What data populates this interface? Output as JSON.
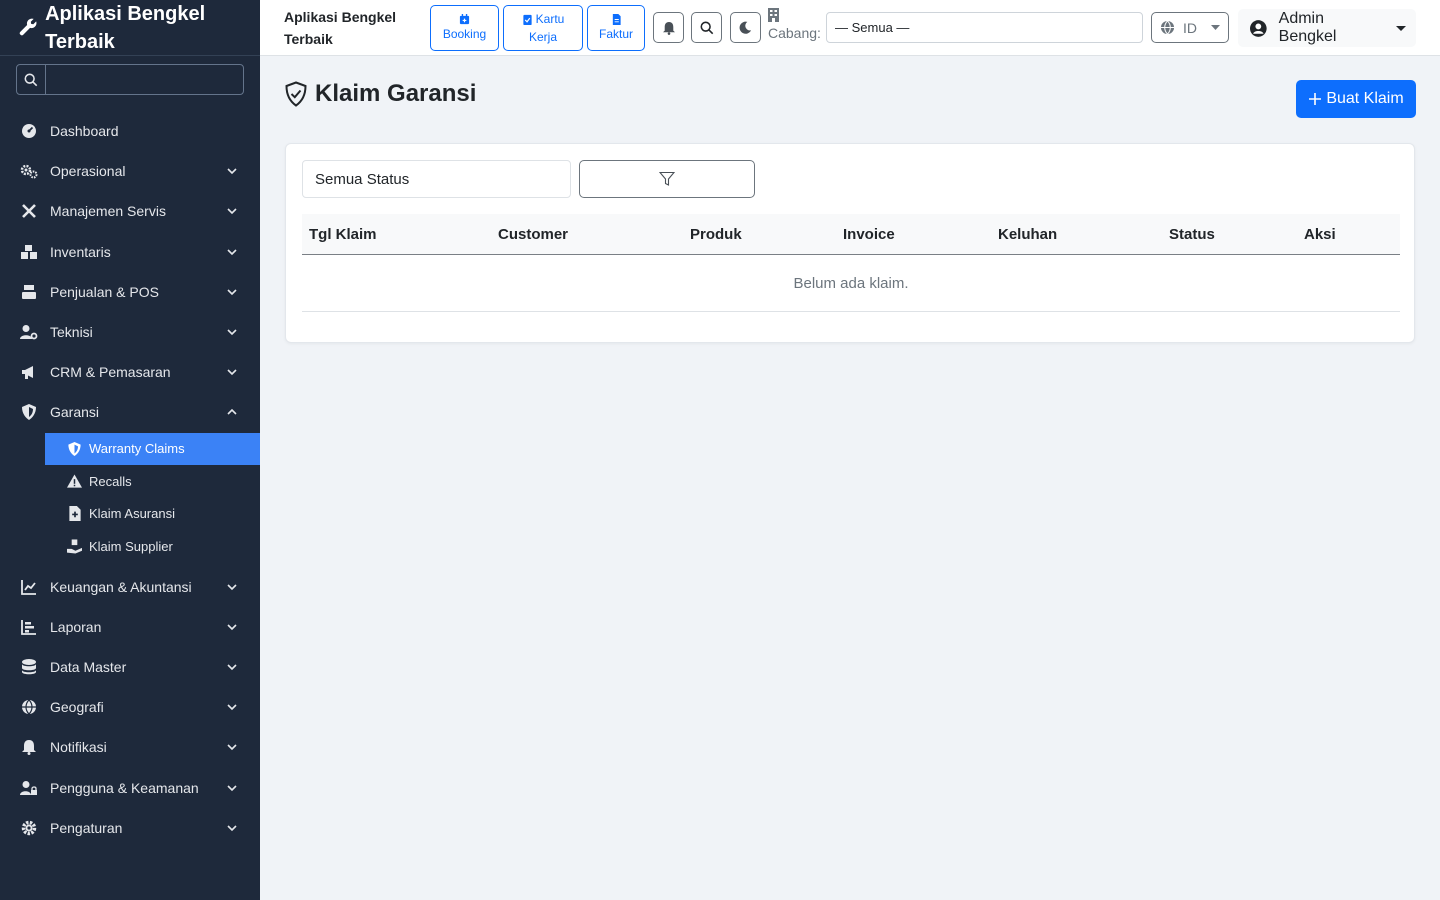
{
  "brand": {
    "title": "Aplikasi Bengkel Terbaik"
  },
  "sidebar": {
    "search_placeholder": "",
    "items": [
      {
        "label": "Dashboard",
        "icon": "dashboard-icon"
      },
      {
        "label": "Operasional",
        "icon": "gears-icon"
      },
      {
        "label": "Manajemen Servis",
        "icon": "tools-icon"
      },
      {
        "label": "Inventaris",
        "icon": "boxes-icon"
      },
      {
        "label": "Penjualan & POS",
        "icon": "cash-register-icon"
      },
      {
        "label": "Teknisi",
        "icon": "user-gear-icon"
      },
      {
        "label": "CRM & Pemasaran",
        "icon": "megaphone-icon"
      },
      {
        "label": "Garansi",
        "icon": "shield-icon"
      }
    ],
    "garansi_sub": [
      {
        "label": "Warranty Claims"
      },
      {
        "label": "Recalls"
      },
      {
        "label": "Klaim Asuransi"
      },
      {
        "label": "Klaim Supplier"
      }
    ],
    "items_after": [
      {
        "label": "Keuangan & Akuntansi"
      },
      {
        "label": "Laporan"
      },
      {
        "label": "Data Master"
      },
      {
        "label": "Geografi"
      },
      {
        "label": "Notifikasi"
      },
      {
        "label": "Pengguna & Keamanan"
      },
      {
        "label": "Pengaturan"
      }
    ]
  },
  "topbar": {
    "app_name": "Aplikasi Bengkel Terbaik",
    "booking": "Booking",
    "kartu_kerja_1": "Kartu",
    "kartu_kerja_2": "Kerja",
    "faktur": "Faktur",
    "cabang_label": "Cabang:",
    "cabang_value": "— Semua —",
    "lang": "ID",
    "user": "Admin Bengkel"
  },
  "main": {
    "title": "Klaim Garansi",
    "new_button": "Buat Klaim",
    "status_filter": "Semua Status",
    "columns": [
      "Tgl Klaim",
      "Customer",
      "Produk",
      "Invoice",
      "Keluhan",
      "Status",
      "Aksi"
    ],
    "empty_text": "Belum ada klaim."
  },
  "colors": {
    "sidebar_bg": "#1e293b",
    "primary": "#0d6efd",
    "active_item": "#3b82f6"
  }
}
